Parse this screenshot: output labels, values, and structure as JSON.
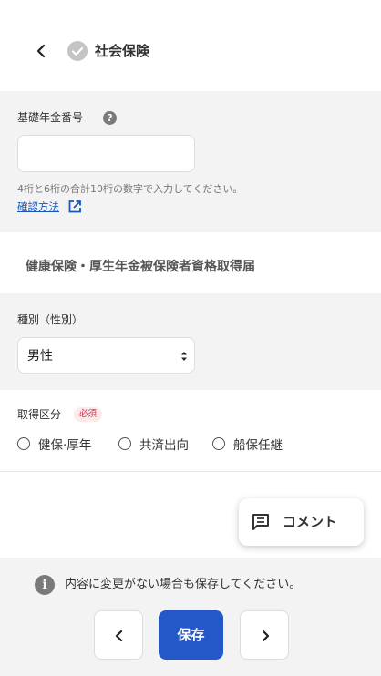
{
  "header": {
    "title": "社会保険"
  },
  "pension_section": {
    "label": "基礎年金番号",
    "input_value": "",
    "hint": "4桁と6桁の合計10桁の数字で入力してください。",
    "link_text": "確認方法"
  },
  "insurance_section": {
    "heading": "健康保険・厚生年金被保険者資格取得届",
    "gender_label": "種別（性別）",
    "gender_value": "男性",
    "category_label": "取得区分",
    "required_badge": "必須",
    "options": [
      "健保·厚年",
      "共済出向",
      "船保任継"
    ]
  },
  "comment_button": {
    "label": "コメント"
  },
  "footer": {
    "info": "内容に変更がない場合も保存してください。",
    "save_label": "保存"
  },
  "colors": {
    "accent": "#2458c9",
    "link": "#1a56b8",
    "section_bg": "#f4f3f3",
    "required_bg": "#fde8ea",
    "required_text": "#c0334a"
  },
  "icons": [
    "back-icon",
    "check-circle-icon",
    "help-icon",
    "external-link-icon",
    "select-arrows-icon",
    "comment-icon",
    "info-icon",
    "chevron-left-icon",
    "chevron-right-icon"
  ]
}
